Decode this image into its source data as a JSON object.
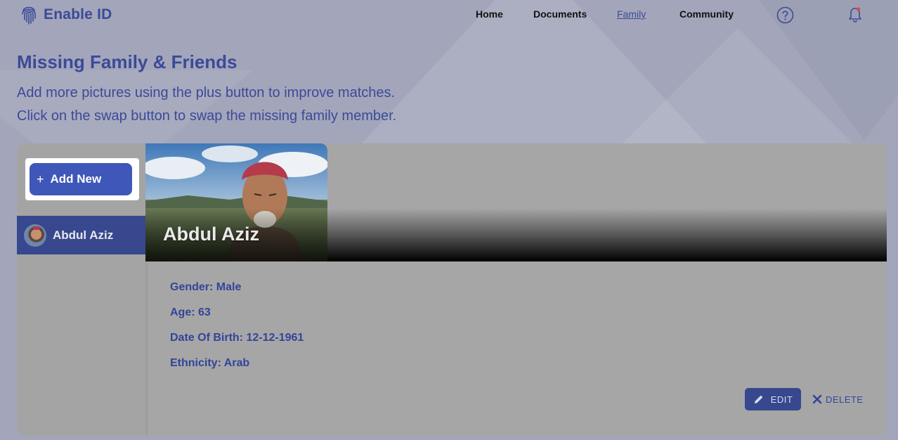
{
  "app": {
    "name": "Enable ID",
    "logo_icon": "fingerprint-icon"
  },
  "nav": {
    "items": [
      {
        "label": "Home",
        "active": false
      },
      {
        "label": "Documents",
        "active": false
      },
      {
        "label": "Family",
        "active": true
      },
      {
        "label": "Community",
        "active": false
      }
    ],
    "help_icon": "question-circle-icon",
    "notification_icon": "bell-icon",
    "notification_dot_color": "#e04848"
  },
  "page": {
    "title": "Missing Family & Friends",
    "subtitle_line1": "Add more pictures using the plus button to improve matches.",
    "subtitle_line2": "Click on the swap button to swap the missing family member."
  },
  "sidebar": {
    "add_button_label": "Add New",
    "add_button_icon": "plus-icon",
    "members": [
      {
        "name": "Abdul Aziz",
        "selected": true
      }
    ]
  },
  "profile": {
    "name": "Abdul Aziz",
    "details": {
      "gender": "Gender: Male",
      "age": "Age: 63",
      "dob": "Date Of Birth: 12-12-1961",
      "ethnicity": "Ethnicity: Arab"
    },
    "edit_label": "EDIT",
    "delete_label": "DELETE"
  },
  "colors": {
    "brand": "#3b4a98",
    "button": "#3f57b8",
    "selected_item": "#37488e",
    "card": "#a6a6a6"
  }
}
